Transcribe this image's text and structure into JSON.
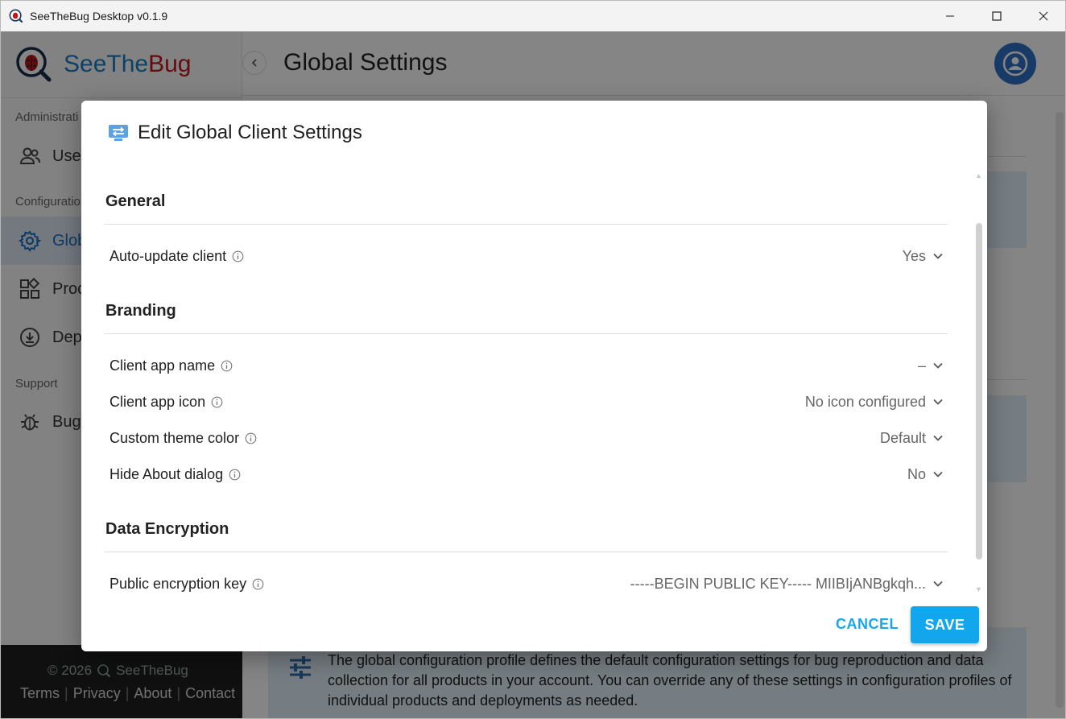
{
  "window": {
    "title": "SeeTheBug Desktop v0.1.9"
  },
  "logo": {
    "part1": "See",
    "part2": "The",
    "part3": "Bug"
  },
  "sidebar": {
    "sections": [
      {
        "label": "Administrati"
      },
      {
        "label": "Configuratio"
      },
      {
        "label": "Support"
      }
    ],
    "items": [
      {
        "label": "User",
        "icon": "users-icon"
      },
      {
        "label": "Glob",
        "icon": "gear-icon"
      },
      {
        "label": "Proc",
        "icon": "products-icon"
      },
      {
        "label": "Dep",
        "icon": "download-icon"
      },
      {
        "label": "Bug",
        "icon": "bug-icon"
      }
    ],
    "footer": {
      "copyright": "© 2026",
      "brand": "SeeTheBug",
      "links": [
        "Terms",
        "Privacy",
        "About",
        "Contact"
      ]
    }
  },
  "header": {
    "title": "Global Settings"
  },
  "info_box": {
    "text": "The global configuration profile defines the default configuration settings for bug reproduction and data collection for all products in your account. You can override any of these settings in configuration profiles of individual products and deployments as needed."
  },
  "dialog": {
    "title": "Edit Global Client Settings",
    "sections": [
      {
        "title": "General",
        "rows": [
          {
            "label": "Auto-update client",
            "value": "Yes"
          }
        ]
      },
      {
        "title": "Branding",
        "rows": [
          {
            "label": "Client app name",
            "value": "–"
          },
          {
            "label": "Client app icon",
            "value": "No icon configured"
          },
          {
            "label": "Custom theme color",
            "value": "Default"
          },
          {
            "label": "Hide About dialog",
            "value": "No"
          }
        ]
      },
      {
        "title": "Data Encryption",
        "rows": [
          {
            "label": "Public encryption key",
            "value": "-----BEGIN PUBLIC KEY----- MIIBIjANBgkqh..."
          }
        ]
      }
    ],
    "cancel_label": "CANCEL",
    "save_label": "SAVE"
  },
  "colors": {
    "accent": "#12a7ec",
    "brand_blue": "#1a7fc4",
    "brand_red": "#c0171a",
    "active_nav": "#1a6fc4"
  }
}
